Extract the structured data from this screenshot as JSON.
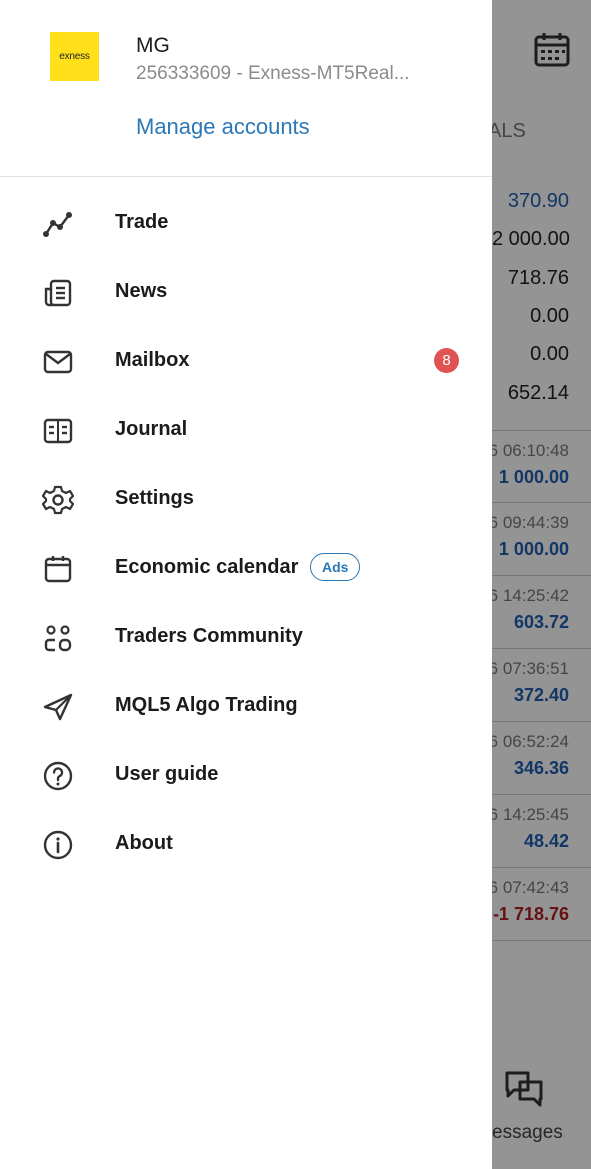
{
  "account": {
    "logo_text": "exness",
    "name": "MG",
    "number": "256333609 - Exness-MT5Real...",
    "manage_label": "Manage accounts"
  },
  "menu": {
    "items": [
      {
        "label": "Trade",
        "icon": "trade-chart-icon"
      },
      {
        "label": "News",
        "icon": "news-icon"
      },
      {
        "label": "Mailbox",
        "icon": "mail-icon",
        "badge": "8"
      },
      {
        "label": "Journal",
        "icon": "journal-icon"
      },
      {
        "label": "Settings",
        "icon": "gear-icon"
      },
      {
        "label": "Economic calendar",
        "icon": "calendar-icon",
        "tag": "Ads"
      },
      {
        "label": "Traders Community",
        "icon": "community-icon"
      },
      {
        "label": "MQL5 Algo Trading",
        "icon": "send-icon"
      },
      {
        "label": "User guide",
        "icon": "help-icon"
      },
      {
        "label": "About",
        "icon": "info-icon"
      }
    ]
  },
  "background": {
    "column_header": "ALS",
    "summary_values": [
      "370.90",
      "2 000.00",
      "718.76",
      "0.00",
      "0.00",
      "652.14"
    ],
    "deals": [
      {
        "time": "6 06:10:48",
        "amount": "1 000.00"
      },
      {
        "time": "6 09:44:39",
        "amount": "1 000.00"
      },
      {
        "time": "6 14:25:42",
        "amount": "603.72"
      },
      {
        "time": "6 07:36:51",
        "amount": "372.40"
      },
      {
        "time": "6 06:52:24",
        "amount": "346.36"
      },
      {
        "time": "6 14:25:45",
        "amount": "48.42"
      },
      {
        "time": "6 07:42:43",
        "amount": "-1 718.76"
      }
    ],
    "bottom_tab_label": "essages"
  },
  "colors": {
    "accent": "#2b78b7",
    "badge": "#e05353",
    "logo_bg": "#ffe01b",
    "negative": "#b02020",
    "positive": "#1f5fb0"
  }
}
